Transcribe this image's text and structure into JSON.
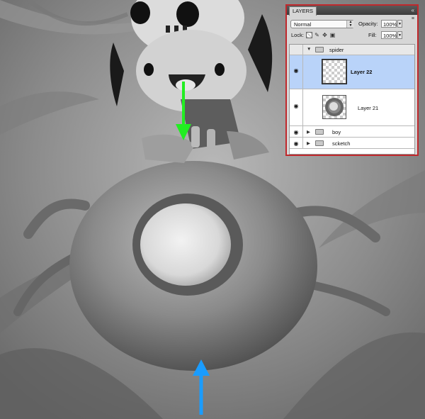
{
  "panel": {
    "tab_label": "LAYERS",
    "blend_mode": "Normal",
    "opacity_label": "Opacity:",
    "opacity_value": "100%",
    "lock_label": "Lock:",
    "fill_label": "Fill:",
    "fill_value": "100%",
    "layers": [
      {
        "name": "spider",
        "kind": "group",
        "expanded": true
      },
      {
        "name": "Layer 22",
        "kind": "layer",
        "selected": true
      },
      {
        "name": "Layer 21",
        "kind": "layer",
        "selected": false
      },
      {
        "name": "boy",
        "kind": "group",
        "expanded": false
      },
      {
        "name": "scketch",
        "kind": "group",
        "expanded": false
      }
    ]
  },
  "annotations": {
    "green_arrow_color": "#22ee22",
    "blue_arrow_color": "#1a9cff"
  },
  "icons": [
    "eye-icon",
    "folder-icon",
    "lock-icon",
    "brush-icon",
    "move-icon",
    "checker-icon"
  ]
}
